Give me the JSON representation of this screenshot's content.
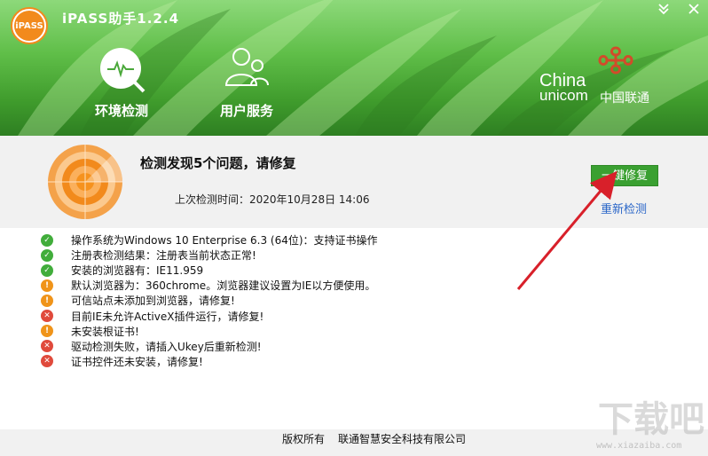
{
  "app": {
    "title": "iPASS助手1.2.4",
    "logo_text": "iPASS"
  },
  "window_controls": {
    "minimize": "≫",
    "close": "✕"
  },
  "nav": [
    {
      "label": "环境检测",
      "icon": "scan-icon"
    },
    {
      "label": "用户服务",
      "icon": "users-icon"
    }
  ],
  "brand": {
    "line1": "China",
    "line2": "unicom",
    "cn": "中国联通"
  },
  "status": {
    "title": "检测发现5个问题，请修复",
    "last_check": "上次检测时间：2020年10月28日 14:06",
    "fix_button": "一键修复",
    "recheck": "重新检测"
  },
  "results": [
    {
      "status": "ok",
      "text": "操作系统为Windows 10 Enterprise 6.3 (64位)：支持证书操作"
    },
    {
      "status": "ok",
      "text": "注册表检测结果：注册表当前状态正常!"
    },
    {
      "status": "ok",
      "text": "安装的浏览器有：IE11.959"
    },
    {
      "status": "warn",
      "text": "默认浏览器为：360chrome。浏览器建议设置为IE以方便使用。"
    },
    {
      "status": "warn",
      "text": "可信站点未添加到浏览器，请修复!"
    },
    {
      "status": "err",
      "text": "目前IE未允许ActiveX插件运行，请修复!"
    },
    {
      "status": "warn",
      "text": "未安装根证书!"
    },
    {
      "status": "err",
      "text": "驱动检测失败，请插入Ukey后重新检测!"
    },
    {
      "status": "err",
      "text": "证书控件还未安装，请修复!"
    }
  ],
  "footer": {
    "copyright": "版权所有",
    "company": "联通智慧安全科技有限公司"
  },
  "watermark": {
    "main": "下载吧",
    "url": "www.xiazaiba.com"
  },
  "colors": {
    "accent_green": "#3aa031",
    "link_blue": "#2a66c8",
    "ok": "#41ad3b",
    "warn": "#f0941a",
    "error": "#e04a3c",
    "annotation_arrow": "#d8202a"
  }
}
